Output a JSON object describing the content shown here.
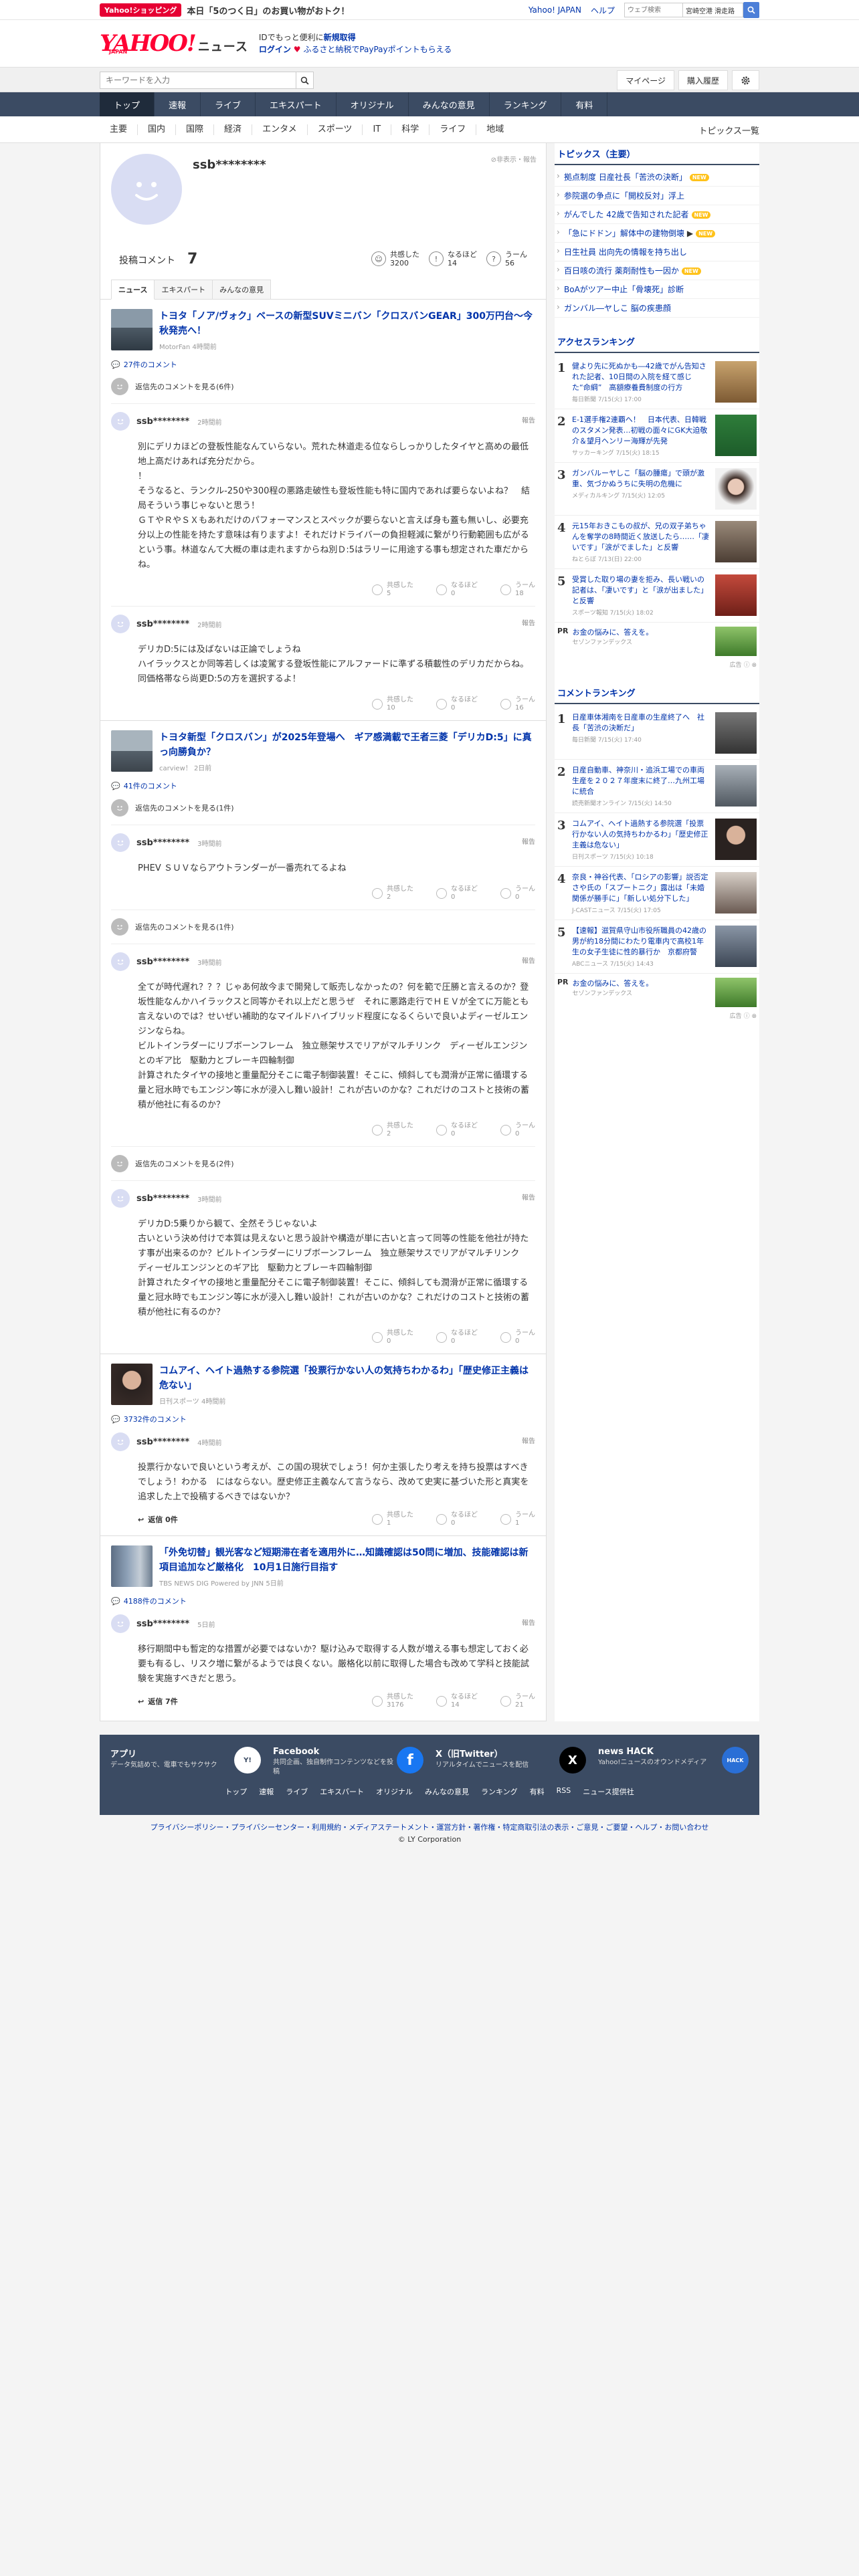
{
  "promo": {
    "badge": "Yahoo!ショッピング",
    "text": "本日「5のつく日」のお買い物がおトク！"
  },
  "toplinks": {
    "yahoo": "Yahoo! JAPAN",
    "help": "ヘルプ",
    "search_placeholder": "ウェブ検索",
    "search_value": "宮崎空港 滑走路"
  },
  "header": {
    "logo": "YAHOO!",
    "logo_sub": "JAPAN",
    "news": "ニュース",
    "promo1": "IDでもっと便利に",
    "promo1_link": "新規取得",
    "login": "ログイン",
    "promo2": "ふるさと納税でPayPayポイントもらえる"
  },
  "searchbar": {
    "placeholder": "キーワードを入力",
    "mypage": "マイページ",
    "history": "購入履歴"
  },
  "gnav": [
    "トップ",
    "速報",
    "ライブ",
    "エキスパート",
    "オリジナル",
    "みんなの意見",
    "ランキング",
    "有料"
  ],
  "catnav": [
    "主要",
    "国内",
    "国際",
    "経済",
    "エンタメ",
    "スポーツ",
    "IT",
    "科学",
    "ライフ",
    "地域"
  ],
  "catnav_right": "トピックス一覧",
  "profile": {
    "name": "ssb********",
    "hide_report": "非表示・報告",
    "comment_label": "投稿コメント",
    "comment_count": "7",
    "reactions": [
      {
        "label": "共感した",
        "value": "3200",
        "icon": "thumb-up-icon"
      },
      {
        "label": "なるほど",
        "value": "14",
        "icon": "lightbulb-icon"
      },
      {
        "label": "うーん",
        "value": "56",
        "icon": "thinking-icon"
      }
    ]
  },
  "tabs": [
    "ニュース",
    "エキスパート",
    "みんなの意見"
  ],
  "articles": [
    {
      "title": "トヨタ「ノア/ヴォク」ベースの新型SUVミニバン「クロスバンGEAR」300万円台～今秋発売へ！",
      "meta": "MotorFan 4時間前",
      "comments": "27件のコメント",
      "replies_label": "返信先のコメントを見る(6件)",
      "items": [
        {
          "name": "ssb********",
          "time": "2時間前",
          "body": "別にデリカほどの登板性能なんていらない。荒れた林道走る位ならしっかりしたタイヤと高めの最低地上高だけあれば充分だから。\n！\nそうなると、ランクル-250や300程の悪路走破性も登坂性能も特に国内であれば要らないよね？　結局そういう事じゃないと思う！\nＧＴやＲやＳＸもあれだけのパフォーマンスとスペックが要らないと言えば身も蓋も無いし、必要充分以上の性能を持たす意味は有りますよ！それだけドライバーの負担軽減に繋がり行動範囲も広がるという事。林道なんて大概の車は走れますからね別Ｄ:5はラリーに用途する事も想定された車だからね。",
          "r1": "5",
          "r2": "0",
          "r3": "18"
        },
        {
          "name": "ssb********",
          "time": "2時間前",
          "body": "デリカD:5には及ばないは正論でしょうね\nハイラックスとか同等若しくは凌駕する登坂性能にアルファードに準ずる積載性のデリカだからね。同価格帯なら尚更D:5の方を選択するよ！",
          "r1": "10",
          "r2": "0",
          "r3": "16"
        }
      ]
    },
    {
      "title": "トヨタ新型「クロスバン」が2025年登場へ　ギア感満載で王者三菱「デリカD:5」に真っ向勝負か？",
      "meta": "carview！ 2日前",
      "comments": "41件のコメント",
      "replies_label": "返信先のコメントを見る(1件)",
      "replies_label2": "返信先のコメントを見る(1件)",
      "replies_label3": "返信先のコメントを見る(2件)",
      "items": [
        {
          "name": "ssb********",
          "time": "3時間前",
          "body": "PHEV ＳＵＶならアウトランダーが一番売れてるよね",
          "r1": "2",
          "r2": "0",
          "r3": "0"
        },
        {
          "name": "ssb********",
          "time": "3時間前",
          "body": "全てが時代遅れ？？？じゃあ何故今まで開発して販売しなかったの？何を範で圧勝と言えるのか？登坂性能なんかハイラックスと同等かそれ以上だと思うぜ　それに悪路走行でＨＥＶが全てに万能とも言えないのでは？せいぜい補助的なマイルドハイブリッド程度になるくらいで良いよディーゼルエンジンならね。\nビルトインラダーにリブボーンフレーム　独立懸架サスでリアがマルチリンク　ディーゼルエンジンとのギア比　駆動力とブレーキ四輪制御\n計算されたタイヤの接地と重量配分そこに電子制御装置！そこに、傾斜しても潤滑が正常に循環する量と冠水時でもエンジン等に水が浸入し難い設計！これが古いのかな？これだけのコストと技術の蓄積が他社に有るのか？",
          "r1": "2",
          "r2": "0",
          "r3": "0"
        },
        {
          "name": "ssb********",
          "time": "3時間前",
          "body": "デリカD:5乗りから観て、全然そうじゃないよ\n古いという決め付けで本質は見えないと思う設計や構造が単に古いと言って同等の性能を他社が持たす事が出来るのか？ビルトインラダーにリブボーンフレーム　独立懸架サスでリアがマルチリンク　ディーゼルエンジンとのギア比　駆動力とブレーキ四輪制御\n計算されたタイヤの接地と重量配分そこに電子制御装置！そこに、傾斜しても潤滑が正常に循環する量と冠水時でもエンジン等に水が浸入し難い設計！これが古いのかな？これだけのコストと技術の蓄積が他社に有るのか？",
          "r1": "0",
          "r2": "0",
          "r3": "0"
        }
      ]
    },
    {
      "title": "コムアイ、ヘイト過熱する参院選「投票行かない人の気持ちわかるわ」「歴史修正主義は危ない」",
      "meta": "日刊スポーツ 4時間前",
      "comments": "3732件のコメント",
      "items": [
        {
          "name": "ssb********",
          "time": "4時間前",
          "body": "投票行かないで良いという考えが、この国の現状でしょう！何か主張したり考えを持ち投票はすべきでしょう！わかる　にはならない。歴史修正主義なんて言うなら、改めて史実に基づいた形と真実を追求した上で投稿するべきではないか？",
          "reply": "返信 0件",
          "r1": "1",
          "r2": "0",
          "r3": "1"
        }
      ]
    },
    {
      "title": "「外免切替」観光客など短期滞在者を適用外に…知識確認は50問に増加、技能確認は新項目追加など厳格化　10月1日施行目指す",
      "meta": "TBS NEWS DIG Powered by JNN 5日前",
      "comments": "4188件のコメント",
      "items": [
        {
          "name": "ssb********",
          "time": "5日前",
          "body": "移行期間中も暫定的な措置が必要ではないか？駆け込みで取得する人数が増える事も想定しておく必要も有るし、リスク増に繋がるようでは良くない。厳格化以前に取得した場合も改めて学科と技能試験を実施すべきだと思う。",
          "reply": "返信 7件",
          "r1": "3176",
          "r2": "14",
          "r3": "21"
        }
      ]
    }
  ],
  "topics": {
    "title": "トピックス（主要）",
    "items": [
      {
        "t": "拠点制度 日産社長「苦渋の決断」",
        "new": true
      },
      {
        "t": "参院選の争点に「開校反対」浮上",
        "new": false
      },
      {
        "t": "がんでした 42歳で告知された記者",
        "new": true
      },
      {
        "t": "「急にドドン」解体中の建物倒壊",
        "new": true
      },
      {
        "t": "日生社員 出向先の情報を持ち出し",
        "new": false
      },
      {
        "t": "百日咳の流行 薬剤耐性も一因か",
        "new": true
      },
      {
        "t": "BoAがツアー中止「骨壊死」診断",
        "new": false
      },
      {
        "t": "ガンバル―ヤしこ 脳の疾患顔",
        "new": false
      }
    ],
    "new_label": "NEW"
  },
  "access_ranking": {
    "title": "アクセスランキング",
    "items": [
      {
        "t": "健より先に死ぬかも―42歳でがん告知された記者、10日間の入院を経て感じた“命綱”　高額療養費制度の行方",
        "s": "毎日新聞 7/15(火) 17:00"
      },
      {
        "t": "E-1選手権2連覇へ！　日本代表、日韓戦のスタメン発表…初戦の面々にGK大迫敬介＆望月ヘンリー海輝が先発",
        "s": "サッカーキング 7/15(火) 18:15"
      },
      {
        "t": "ガンバルーヤしこ「脳の腫瘍」で頭が激重、気づかぬうちに失明の危機に",
        "s": "メディカルキング 7/15(火) 12:05"
      },
      {
        "t": "元15年おきこもの叔が、兄の双子弟ちゃんを奪学の8時間近く放送したら……「凄いです」「涙がでました」と反響",
        "s": "ねとらぼ 7/13(日) 22:00"
      },
      {
        "t": "受賞した取り場の妻を拒み、長い戦いの記者は、「凄いです」と「涙が出ました」と反響",
        "s": "スポーツ報知 7/15(火) 18:02"
      }
    ]
  },
  "pr1": {
    "tag": "PR",
    "t": "お金の悩みに、答えを。",
    "s": "セゾンファンデックス"
  },
  "comment_ranking": {
    "title": "コメントランキング",
    "items": [
      {
        "t": "日産車体湘南を日産車の生産終了へ　社長「苦渋の決断だ」",
        "s": "毎日新聞 7/15(火) 17:40"
      },
      {
        "t": "日産自動車、神奈川・追浜工場での車両生産を２０２７年度末に終了…九州工場に統合",
        "s": "読売新聞オンライン 7/15(火) 14:50"
      },
      {
        "t": "コムアイ、ヘイト過熱する参院選「投票行かない人の気持ちわかるわ」「歴史修正主義は危ない」",
        "s": "日刊スポーツ 7/15(火) 10:18"
      },
      {
        "t": "奈良・神谷代表、「ロシアの影響」説否定　さや氏の「スプートニク」露出は「未婚関係が勝手に」「新しい処分下した」",
        "s": "J-CASTニュース 7/15(火) 17:05"
      },
      {
        "t": "【速報】滋賀県守山市役所職員の42歳の男が約18分間にわたり電車内で高校1年生の女子生徒に性的暴行か　京都府警",
        "s": "ABCニュース 7/15(火) 14:43"
      }
    ]
  },
  "pr2": {
    "tag": "PR",
    "t": "お金の悩みに、答えを。",
    "s": "セゾンファンデックス"
  },
  "ad_label": "広告",
  "footer": {
    "apps": [
      {
        "t": "アプリ",
        "d": "データ気詰めで、電車でもサクサク",
        "icon": "yahoo-news-app-icon"
      },
      {
        "t": "Facebook",
        "d": "共同企画、独自制作コンテンツなどを投稿",
        "icon": "facebook-icon"
      },
      {
        "t": "X（旧Twitter）",
        "d": "リアルタイムでニュースを配信",
        "icon": "x-icon"
      },
      {
        "t": "news HACK",
        "d": "Yahoo!ニュースのオウンドメディア",
        "icon": "newshack-icon"
      }
    ],
    "links": [
      "トップ",
      "速報",
      "ライブ",
      "エキスパート",
      "オリジナル",
      "みんなの意見",
      "ランキング",
      "有料",
      "RSS",
      "ニュース提供社"
    ]
  },
  "bottom": {
    "links": "プライバシーポリシー・プライバシーセンター・利用規約・メディアステートメント・運営方針・著作権・特定商取引法の表示・ご意見・ご要望・ヘルプ・お問い合わせ",
    "copyright": "© LY Corporation"
  }
}
